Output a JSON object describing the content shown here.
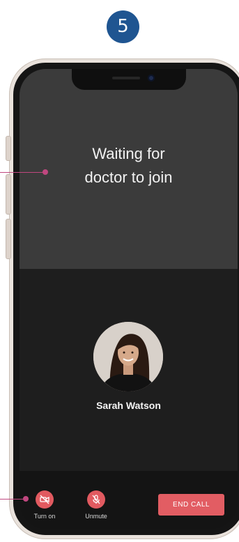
{
  "step": {
    "number": "5"
  },
  "call": {
    "waiting_line1": "Waiting for",
    "waiting_line2": "doctor to join",
    "participant_name": "Sarah Watson"
  },
  "controls": {
    "camera_label": "Turn on",
    "mic_label": "Unmute",
    "end_call_label": "END CALL"
  },
  "colors": {
    "step_badge": "#1f5591",
    "accent_red": "#e15a60",
    "annotation": "#c0477f",
    "remote_video_bg": "#3b3b3b",
    "local_video_bg": "#1e1e1e"
  },
  "icons": [
    "camera-off-icon",
    "mic-off-icon"
  ]
}
